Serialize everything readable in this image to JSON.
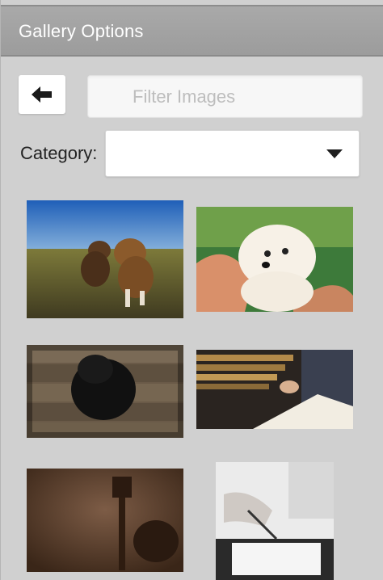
{
  "header": {
    "title": "Gallery Options"
  },
  "toolbar": {
    "back_icon": "arrow-left-icon"
  },
  "search": {
    "placeholder": "Filter Images",
    "value": ""
  },
  "category": {
    "label": "Category:",
    "selected": "",
    "icon": "caret-down-icon"
  },
  "gallery": {
    "images": [
      {
        "subject": "two dogs running on grass"
      },
      {
        "subject": "white puppy held in arms"
      },
      {
        "subject": "black puppy on wooden floor"
      },
      {
        "subject": "hands writing in notebook near books"
      },
      {
        "subject": "wooden gavel on table"
      },
      {
        "subject": "hand signing document"
      }
    ]
  },
  "colors": {
    "header_bg": "#a3a3a3",
    "panel_bg": "#d0d0d0",
    "white": "#ffffff"
  }
}
